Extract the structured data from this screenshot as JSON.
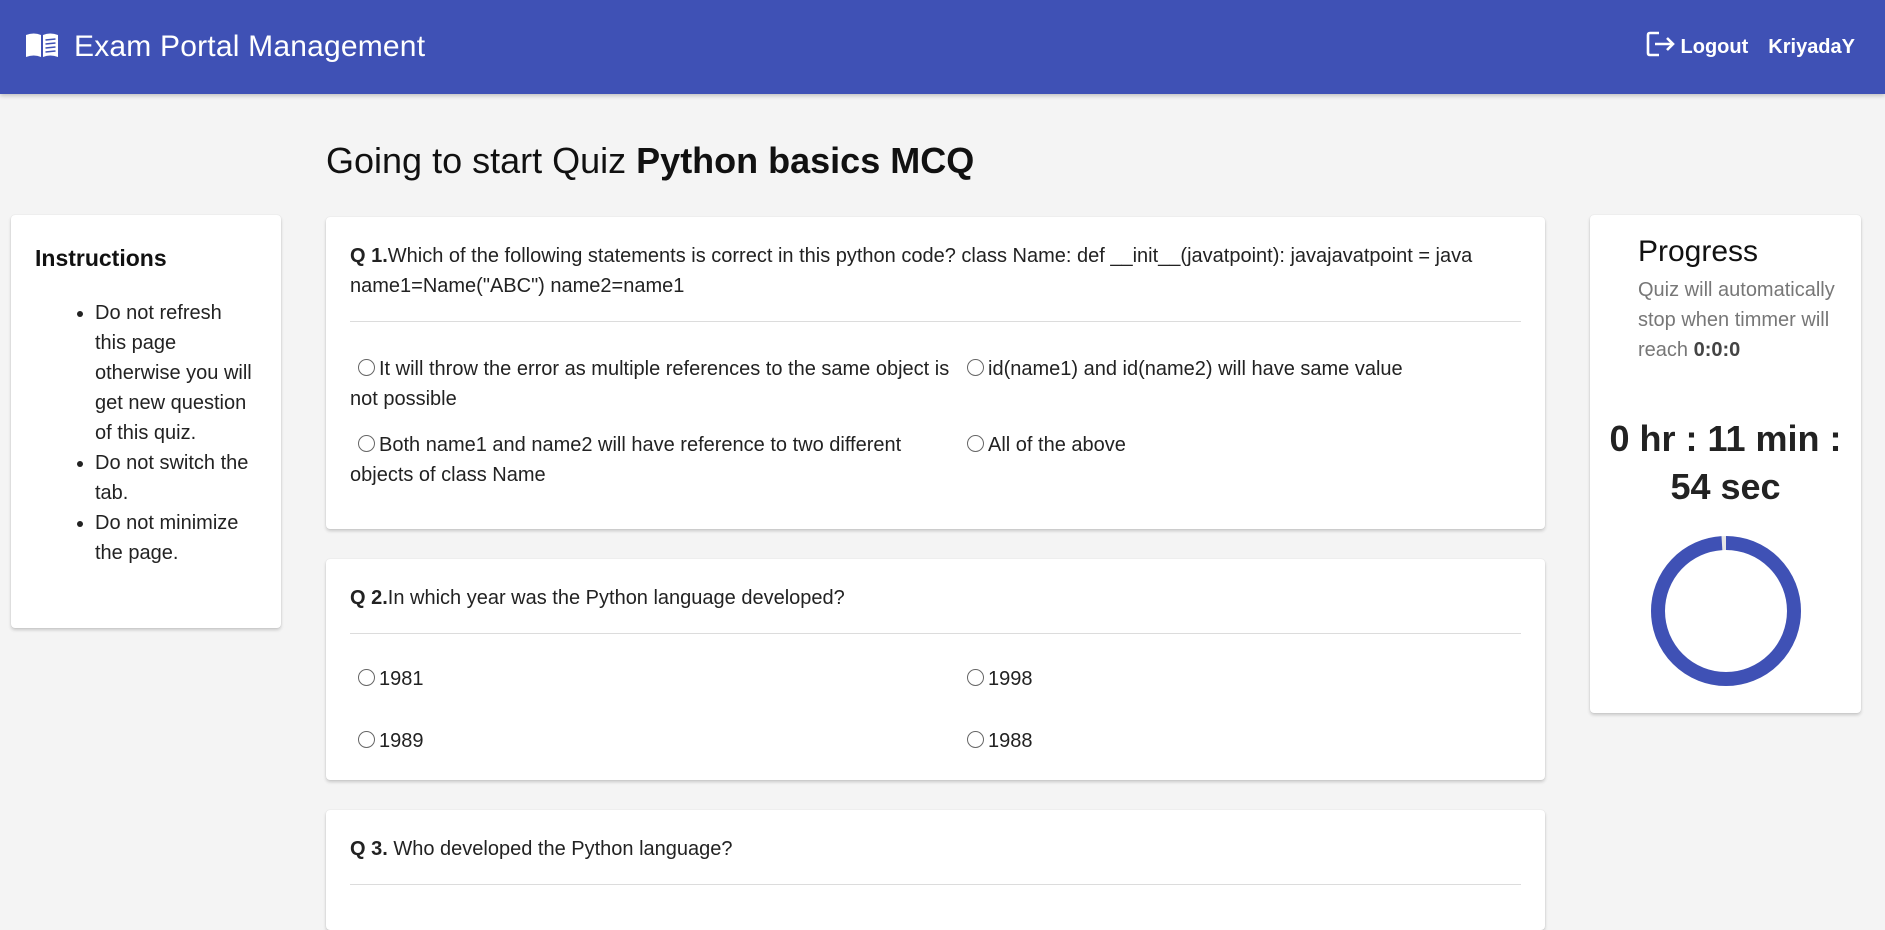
{
  "header": {
    "title": "Exam Portal Management",
    "logout_label": "Logout",
    "username": "KriyadaY",
    "brand_icon": "book-icon",
    "logout_icon": "logout-icon",
    "color": "#3f51b5"
  },
  "heading": {
    "prefix": "Going to start Quiz",
    "quiz_name": "Python basics MCQ"
  },
  "instructions": {
    "title": "Instructions",
    "items": [
      "Do not refresh this page otherwise you will get new question of this quiz.",
      "Do not switch the tab.",
      "Do not minimize the page."
    ]
  },
  "questions": [
    {
      "number": "Q 1.",
      "text": "Which of the following statements is correct in this python code? class Name: def __init__(javatpoint): javajavatpoint = java name1=Name(\"ABC\") name2=name1",
      "options": [
        "It will throw the error as multiple references to the same object is not possible",
        "id(name1) and id(name2) will have same value",
        "Both name1 and name2 will have reference to two different objects of class Name",
        "All of the above"
      ]
    },
    {
      "number": "Q 2.",
      "text": "In which year was the Python language developed?",
      "options": [
        "1981",
        "1998",
        "1989",
        "1988"
      ]
    },
    {
      "number": "Q 3.",
      "text": " Who developed the Python language?",
      "options": []
    }
  ],
  "progress": {
    "title": "Progress",
    "note_prefix": "Quiz will automatically stop when timmer will reach",
    "note_value": "0:0:0",
    "timer_line1": "0 hr : 11 min :",
    "timer_line2": "54 sec",
    "fraction": 0.99,
    "color": "#3f51b5"
  }
}
